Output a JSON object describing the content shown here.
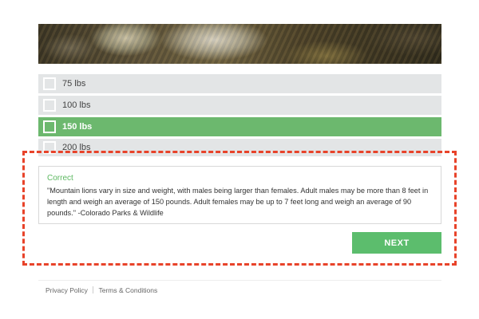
{
  "photo": {
    "description_icon": "mountain-lion-photo"
  },
  "options": [
    {
      "label": "75 lbs",
      "selected": false
    },
    {
      "label": "100 lbs",
      "selected": false
    },
    {
      "label": "150 lbs",
      "selected": true
    },
    {
      "label": "200 lbs",
      "selected": false
    }
  ],
  "feedback": {
    "status": "Correct",
    "text": "\"Mountain lions vary in size and weight, with males being larger than females. Adult males may be more than 8 feet in length and weigh an average of 150 pounds. Adult females may be up to 7 feet long and weigh an average of 90 pounds.\" -Colorado Parks & Wildlife"
  },
  "next_button": {
    "label": "NEXT"
  },
  "footer": {
    "privacy_label": "Privacy Policy",
    "terms_label": "Terms & Conditions"
  },
  "colors": {
    "selected": "#6cb86e",
    "option_bg": "#e3e5e6",
    "correct": "#5cb860",
    "next": "#5cbd6d",
    "highlight": "#e8432a"
  }
}
